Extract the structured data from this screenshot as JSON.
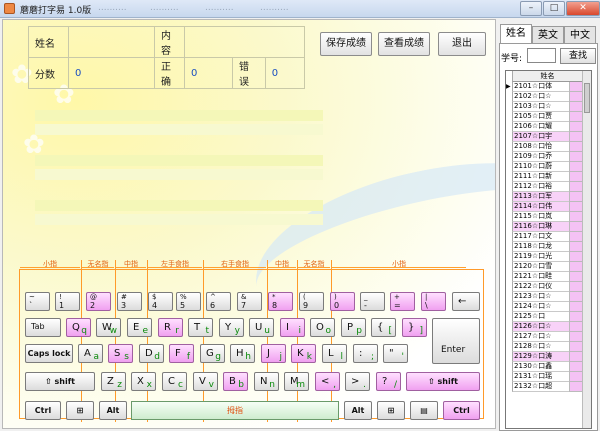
{
  "window": {
    "title": "蘑蘑打字易 1.0版",
    "faint_menu": [
      "..........",
      "..........",
      "..........",
      ".........."
    ],
    "buttons": {
      "minimize": "–",
      "maximize": "□",
      "close": "✕"
    }
  },
  "info": {
    "name_label": "姓名",
    "name_value": "",
    "content_label": "内容",
    "content_value": "",
    "score_label": "分数",
    "score_value": "0",
    "correct_label": "正确",
    "correct_value": "0",
    "error_label": "错误",
    "error_value": "0"
  },
  "actions": {
    "save": "保存成绩",
    "view": "查看成绩",
    "exit": "退出"
  },
  "finger_labels": [
    "小指",
    "无名指",
    "中指",
    "左手食指",
    "右手食指",
    "中指",
    "无名指",
    "小指"
  ],
  "keyboard": {
    "row1": [
      {
        "top": "~",
        "bot": "`"
      },
      {
        "top": "!",
        "bot": "1"
      },
      {
        "top": "@",
        "bot": "2"
      },
      {
        "top": "#",
        "bot": "3"
      },
      {
        "top": "$",
        "bot": "4"
      },
      {
        "top": "%",
        "bot": "5"
      },
      {
        "top": "^",
        "bot": "6"
      },
      {
        "top": "&",
        "bot": "7"
      },
      {
        "top": "*",
        "bot": "8"
      },
      {
        "top": "(",
        "bot": "9"
      },
      {
        "top": ")",
        "bot": "0"
      },
      {
        "top": "_",
        "bot": "-"
      },
      {
        "top": "+",
        "bot": "="
      },
      {
        "top": "|",
        "bot": "\\"
      },
      {
        "top": "←",
        "bot": ""
      }
    ],
    "row2": [
      {
        "main": "Tab",
        "sub": ""
      },
      {
        "main": "Q",
        "sub": "q"
      },
      {
        "main": "W",
        "sub": "w"
      },
      {
        "main": "E",
        "sub": "e"
      },
      {
        "main": "R",
        "sub": "r"
      },
      {
        "main": "T",
        "sub": "t"
      },
      {
        "main": "Y",
        "sub": "y"
      },
      {
        "main": "U",
        "sub": "u"
      },
      {
        "main": "I",
        "sub": "i"
      },
      {
        "main": "O",
        "sub": "o"
      },
      {
        "main": "P",
        "sub": "p"
      },
      {
        "main": "{",
        "sub": "["
      },
      {
        "main": "}",
        "sub": "]"
      }
    ],
    "row3": [
      {
        "main": "Caps lock",
        "sub": ""
      },
      {
        "main": "A",
        "sub": "a"
      },
      {
        "main": "S",
        "sub": "s"
      },
      {
        "main": "D",
        "sub": "d"
      },
      {
        "main": "F",
        "sub": "f"
      },
      {
        "main": "G",
        "sub": "g"
      },
      {
        "main": "H",
        "sub": "h"
      },
      {
        "main": "J",
        "sub": "j"
      },
      {
        "main": "K",
        "sub": "k"
      },
      {
        "main": "L",
        "sub": "l"
      },
      {
        "main": ":",
        "sub": ";"
      },
      {
        "main": "\"",
        "sub": "'"
      }
    ],
    "row4": [
      {
        "main": "⇧ shift",
        "sub": ""
      },
      {
        "main": "Z",
        "sub": "z"
      },
      {
        "main": "X",
        "sub": "x"
      },
      {
        "main": "C",
        "sub": "c"
      },
      {
        "main": "V",
        "sub": "v"
      },
      {
        "main": "B",
        "sub": "b"
      },
      {
        "main": "N",
        "sub": "n"
      },
      {
        "main": "M",
        "sub": "m"
      },
      {
        "main": "<",
        "sub": ","
      },
      {
        "main": ">",
        "sub": "."
      },
      {
        "main": "?",
        "sub": "/"
      },
      {
        "main": "⇧ shift",
        "sub": ""
      }
    ],
    "enter": "Enter",
    "ctrl_l": "Ctrl",
    "win_l": "⊞",
    "alt_l": "Alt",
    "space": "拇指",
    "alt_r": "Alt",
    "win_r": "⊞",
    "menu_r": "▤",
    "ctrl_r": "Ctrl"
  },
  "right_panel": {
    "tabs": [
      "姓名",
      "英文",
      "中文"
    ],
    "id_label": "学号:",
    "id_value": "",
    "find": "查找",
    "col_header": "姓名",
    "rows": [
      "2101☆口体",
      "2102☆口☆",
      "2103☆口☆",
      "2105☆口贾",
      "2106☆口耀",
      "2107☆口宇",
      "2108☆口怡",
      "2109☆口乔",
      "2110☆口蔚",
      "2111☆口新",
      "2112☆口裕",
      "2113☆口军",
      "2114☆口伟",
      "2115☆口岚",
      "2116☆口琳",
      "2117☆口文",
      "2118☆口龙",
      "2119☆口光",
      "2120☆口雪",
      "2121☆口畦",
      "2122☆口仪",
      "2123☆口☆",
      "2124☆口☆",
      "2125☆口",
      "2126☆口☆",
      "2127☆口☆",
      "2128☆口☆",
      "2129☆口涛",
      "2130☆口鑫",
      "2131☆口瑶",
      "2132☆口超"
    ]
  }
}
